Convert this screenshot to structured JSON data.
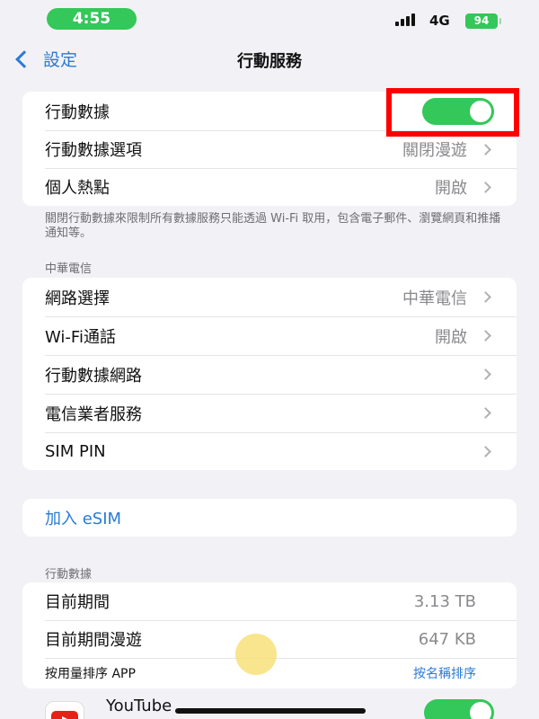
{
  "status": {
    "time": "4:55",
    "network": "4G",
    "battery": "94"
  },
  "nav": {
    "back_label": "設定",
    "title": "行動服務"
  },
  "cellular": {
    "items": [
      {
        "label": "行動數據",
        "toggle": true
      },
      {
        "label": "行動數據選項",
        "value": "關閉漫遊"
      },
      {
        "label": "個人熱點",
        "value": "開啟"
      }
    ],
    "footer": "關閉行動數據來限制所有數據服務只能透過 Wi-Fi 取用，包含電子郵件、瀏覽網頁和推播通知等。"
  },
  "carrier": {
    "header": "中華電信",
    "items": [
      {
        "label": "網路選擇",
        "value": "中華電信"
      },
      {
        "label": "Wi-Fi通話",
        "value": "開啟"
      },
      {
        "label": "行動數據網路",
        "value": ""
      },
      {
        "label": "電信業者服務",
        "value": ""
      },
      {
        "label": "SIM PIN",
        "value": ""
      }
    ]
  },
  "esim": {
    "label": "加入 eSIM"
  },
  "usage": {
    "header": "行動數據",
    "items": [
      {
        "label": "目前期間",
        "value": "3.13 TB"
      },
      {
        "label": "目前期間漫遊",
        "value": "647 KB"
      }
    ],
    "sort_label": "按用量排序 APP",
    "sort_link": "按名稱排序"
  },
  "app": {
    "name": "YouTube",
    "toggle": true
  },
  "colors": {
    "accent": "#2a7bd5",
    "toggle_on": "#34c759",
    "highlight": "#ff0000"
  }
}
